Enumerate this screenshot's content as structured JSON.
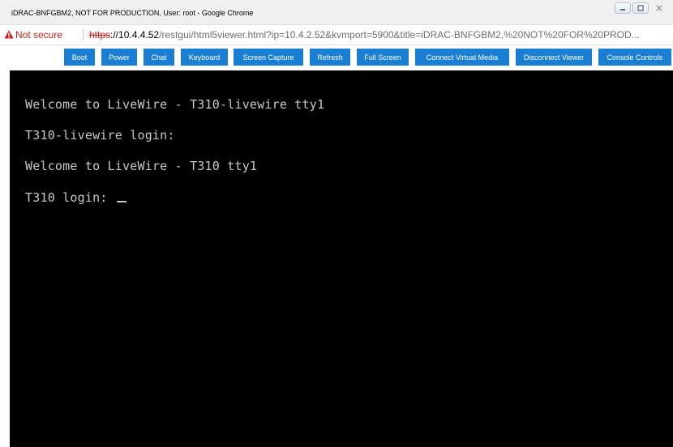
{
  "window": {
    "title": "iDRAC-BNFGBM2, NOT FOR PRODUCTION, User: root - Google Chrome"
  },
  "addressbar": {
    "security_label": "Not secure",
    "url_scheme": "https",
    "url_host_part": "://10.4.4.52",
    "url_path": "/restgui/html5viewer.html?ip=10.4.2.52&kvmport=5900&title=iDRAC-BNFGBM2,%20NOT%20FOR%20PROD..."
  },
  "toolbar": {
    "buttons": [
      "Boot",
      "Power",
      "Chat",
      "Keyboard",
      "Screen Capture",
      "Refresh",
      "Full Screen",
      "Connect Virtual Media",
      "Disconnect Viewer",
      "Console Controls"
    ]
  },
  "console": {
    "lines": [
      "Welcome to LiveWire - T310-livewire tty1",
      "T310-livewire login:",
      "Welcome to LiveWire - T310 tty1",
      "T310 login: "
    ]
  },
  "colors": {
    "toolbar_button": "#1a7fd3",
    "not_secure": "#c5221f",
    "console_bg": "#000000",
    "console_text": "#c8c8c8"
  },
  "icons": {
    "warning": "warning-triangle-icon",
    "minimize": "minimize-icon",
    "maximize": "maximize-icon",
    "close": "close-icon"
  }
}
